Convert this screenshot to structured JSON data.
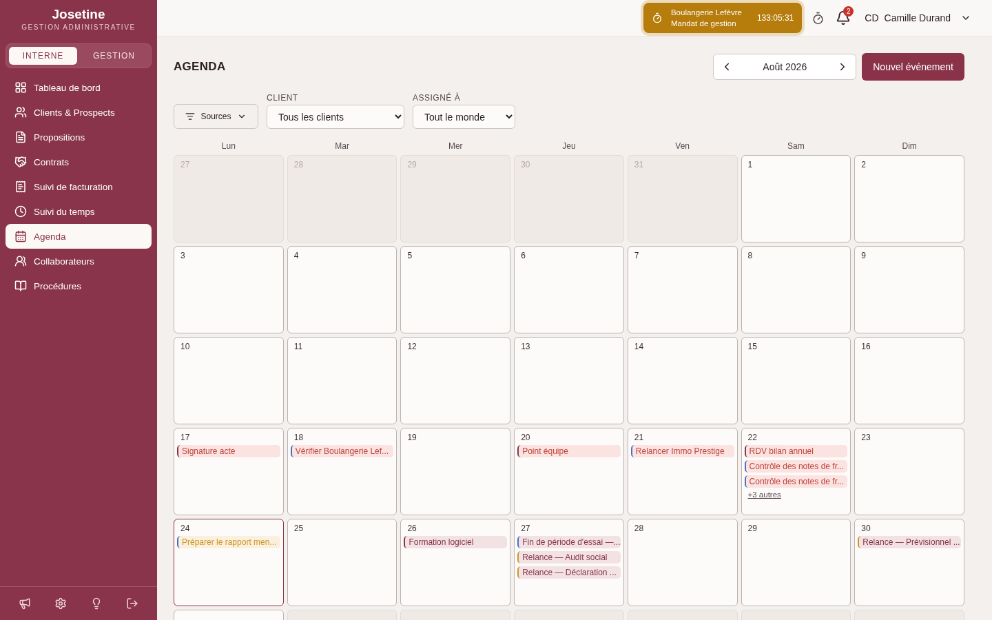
{
  "sidebar": {
    "brand": "Josetine",
    "subtitle": "GESTION ADMINISTRATIVE",
    "modes": [
      {
        "label": "INTERNE",
        "selected": true
      },
      {
        "label": "GESTION",
        "selected": false
      }
    ],
    "items": [
      {
        "label": "Tableau de bord",
        "selected": false
      },
      {
        "label": "Clients & Prospects",
        "selected": false
      },
      {
        "label": "Propositions",
        "selected": false
      },
      {
        "label": "Contrats",
        "selected": false
      },
      {
        "label": "Suivi de facturation",
        "selected": false
      },
      {
        "label": "Suivi du temps",
        "selected": false
      },
      {
        "label": "Agenda",
        "selected": true
      },
      {
        "label": "Collaborateurs",
        "selected": false
      },
      {
        "label": "Procédures",
        "selected": false
      }
    ]
  },
  "topbar": {
    "timer": {
      "client": "Boulangerie Lefèvre",
      "mission": "Mandat de gestion",
      "elapsed": "133:05:31"
    },
    "notifications": "2",
    "user": {
      "initials": "CD",
      "name": "Camille Durand"
    }
  },
  "page": {
    "title": "AGENDA",
    "month": "Août 2026",
    "new_button": "Nouvel événement",
    "filters": {
      "sources": "Sources",
      "client_label": "CLIENT",
      "client_value": "Tous les clients",
      "assignee_label": "ASSIGNÉ À",
      "assignee_value": "Tout le monde"
    }
  },
  "calendar": {
    "weekdays": [
      "Lun",
      "Mar",
      "Mer",
      "Jeu",
      "Ven",
      "Sam",
      "Dim"
    ],
    "days": [
      {
        "day": "27",
        "outside": true,
        "today": false
      },
      {
        "day": "28",
        "outside": true,
        "today": false
      },
      {
        "day": "29",
        "outside": true,
        "today": false
      },
      {
        "day": "30",
        "outside": true,
        "today": false
      },
      {
        "day": "31",
        "outside": true,
        "today": false
      },
      {
        "day": "1",
        "outside": false,
        "today": false
      },
      {
        "day": "2",
        "outside": false,
        "today": false
      },
      {
        "day": "3",
        "outside": false,
        "today": false
      },
      {
        "day": "4",
        "outside": false,
        "today": false
      },
      {
        "day": "5",
        "outside": false,
        "today": false
      },
      {
        "day": "6",
        "outside": false,
        "today": false
      },
      {
        "day": "7",
        "outside": false,
        "today": false
      },
      {
        "day": "8",
        "outside": false,
        "today": false
      },
      {
        "day": "9",
        "outside": false,
        "today": false
      },
      {
        "day": "10",
        "outside": false,
        "today": false
      },
      {
        "day": "11",
        "outside": false,
        "today": false
      },
      {
        "day": "12",
        "outside": false,
        "today": false
      },
      {
        "day": "13",
        "outside": false,
        "today": false
      },
      {
        "day": "14",
        "outside": false,
        "today": false
      },
      {
        "day": "15",
        "outside": false,
        "today": false
      },
      {
        "day": "16",
        "outside": false,
        "today": false
      },
      {
        "day": "17",
        "outside": false,
        "today": false,
        "events": [
          {
            "title": "Signature acte",
            "color": "#8a3348",
            "kind": "urgent"
          }
        ]
      },
      {
        "day": "18",
        "outside": false,
        "today": false,
        "events": [
          {
            "title": "Vérifier Boulangerie Lef...",
            "color": "#4a6fc0",
            "kind": "urgent"
          }
        ]
      },
      {
        "day": "19",
        "outside": false,
        "today": false
      },
      {
        "day": "20",
        "outside": false,
        "today": false,
        "events": [
          {
            "title": "Point équipe",
            "color": "#8a3348",
            "kind": "urgent"
          }
        ]
      },
      {
        "day": "21",
        "outside": false,
        "today": false,
        "events": [
          {
            "title": "Relancer Immo Prestige",
            "color": "#4a6fc0",
            "kind": "urgent"
          }
        ]
      },
      {
        "day": "22",
        "outside": false,
        "today": false,
        "events": [
          {
            "title": "RDV bilan annuel",
            "color": "#8a3348",
            "kind": "urgent"
          },
          {
            "title": "Contrôle des notes de fr...",
            "color": "#4a6fc0",
            "kind": "urgent"
          },
          {
            "title": "Contrôle des notes de fr...",
            "color": "#4a6fc0",
            "kind": "urgent"
          }
        ],
        "more": "+3 autres"
      },
      {
        "day": "23",
        "outside": false,
        "today": false
      },
      {
        "day": "24",
        "outside": false,
        "today": true,
        "events": [
          {
            "title": "Préparer le rapport men...",
            "color": "#4a6fc0",
            "kind": "pending"
          }
        ]
      },
      {
        "day": "25",
        "outside": false,
        "today": false
      },
      {
        "day": "26",
        "outside": false,
        "today": false,
        "events": [
          {
            "title": "Formation logiciel",
            "color": "#8a3348",
            "kind": "planned"
          }
        ]
      },
      {
        "day": "27",
        "outside": false,
        "today": false,
        "events": [
          {
            "title": "Fin de période d'essai —...",
            "color": "#4a6fc0",
            "kind": "planned"
          },
          {
            "title": "Relance — Audit social",
            "color": "#c9972a",
            "kind": "planned"
          },
          {
            "title": "Relance — Déclaration ...",
            "color": "#c9972a",
            "kind": "planned"
          }
        ]
      },
      {
        "day": "28",
        "outside": false,
        "today": false
      },
      {
        "day": "29",
        "outside": false,
        "today": false
      },
      {
        "day": "30",
        "outside": false,
        "today": false,
        "events": [
          {
            "title": "Relance — Prévisionnel ...",
            "color": "#c9972a",
            "kind": "planned"
          }
        ]
      },
      {
        "outside": false,
        "today": false
      },
      {
        "outside": true,
        "today": false
      },
      {
        "outside": true,
        "today": false
      },
      {
        "outside": true,
        "today": false
      },
      {
        "outside": true,
        "today": false
      },
      {
        "outside": true,
        "today": false
      },
      {
        "outside": true,
        "today": false
      }
    ]
  }
}
